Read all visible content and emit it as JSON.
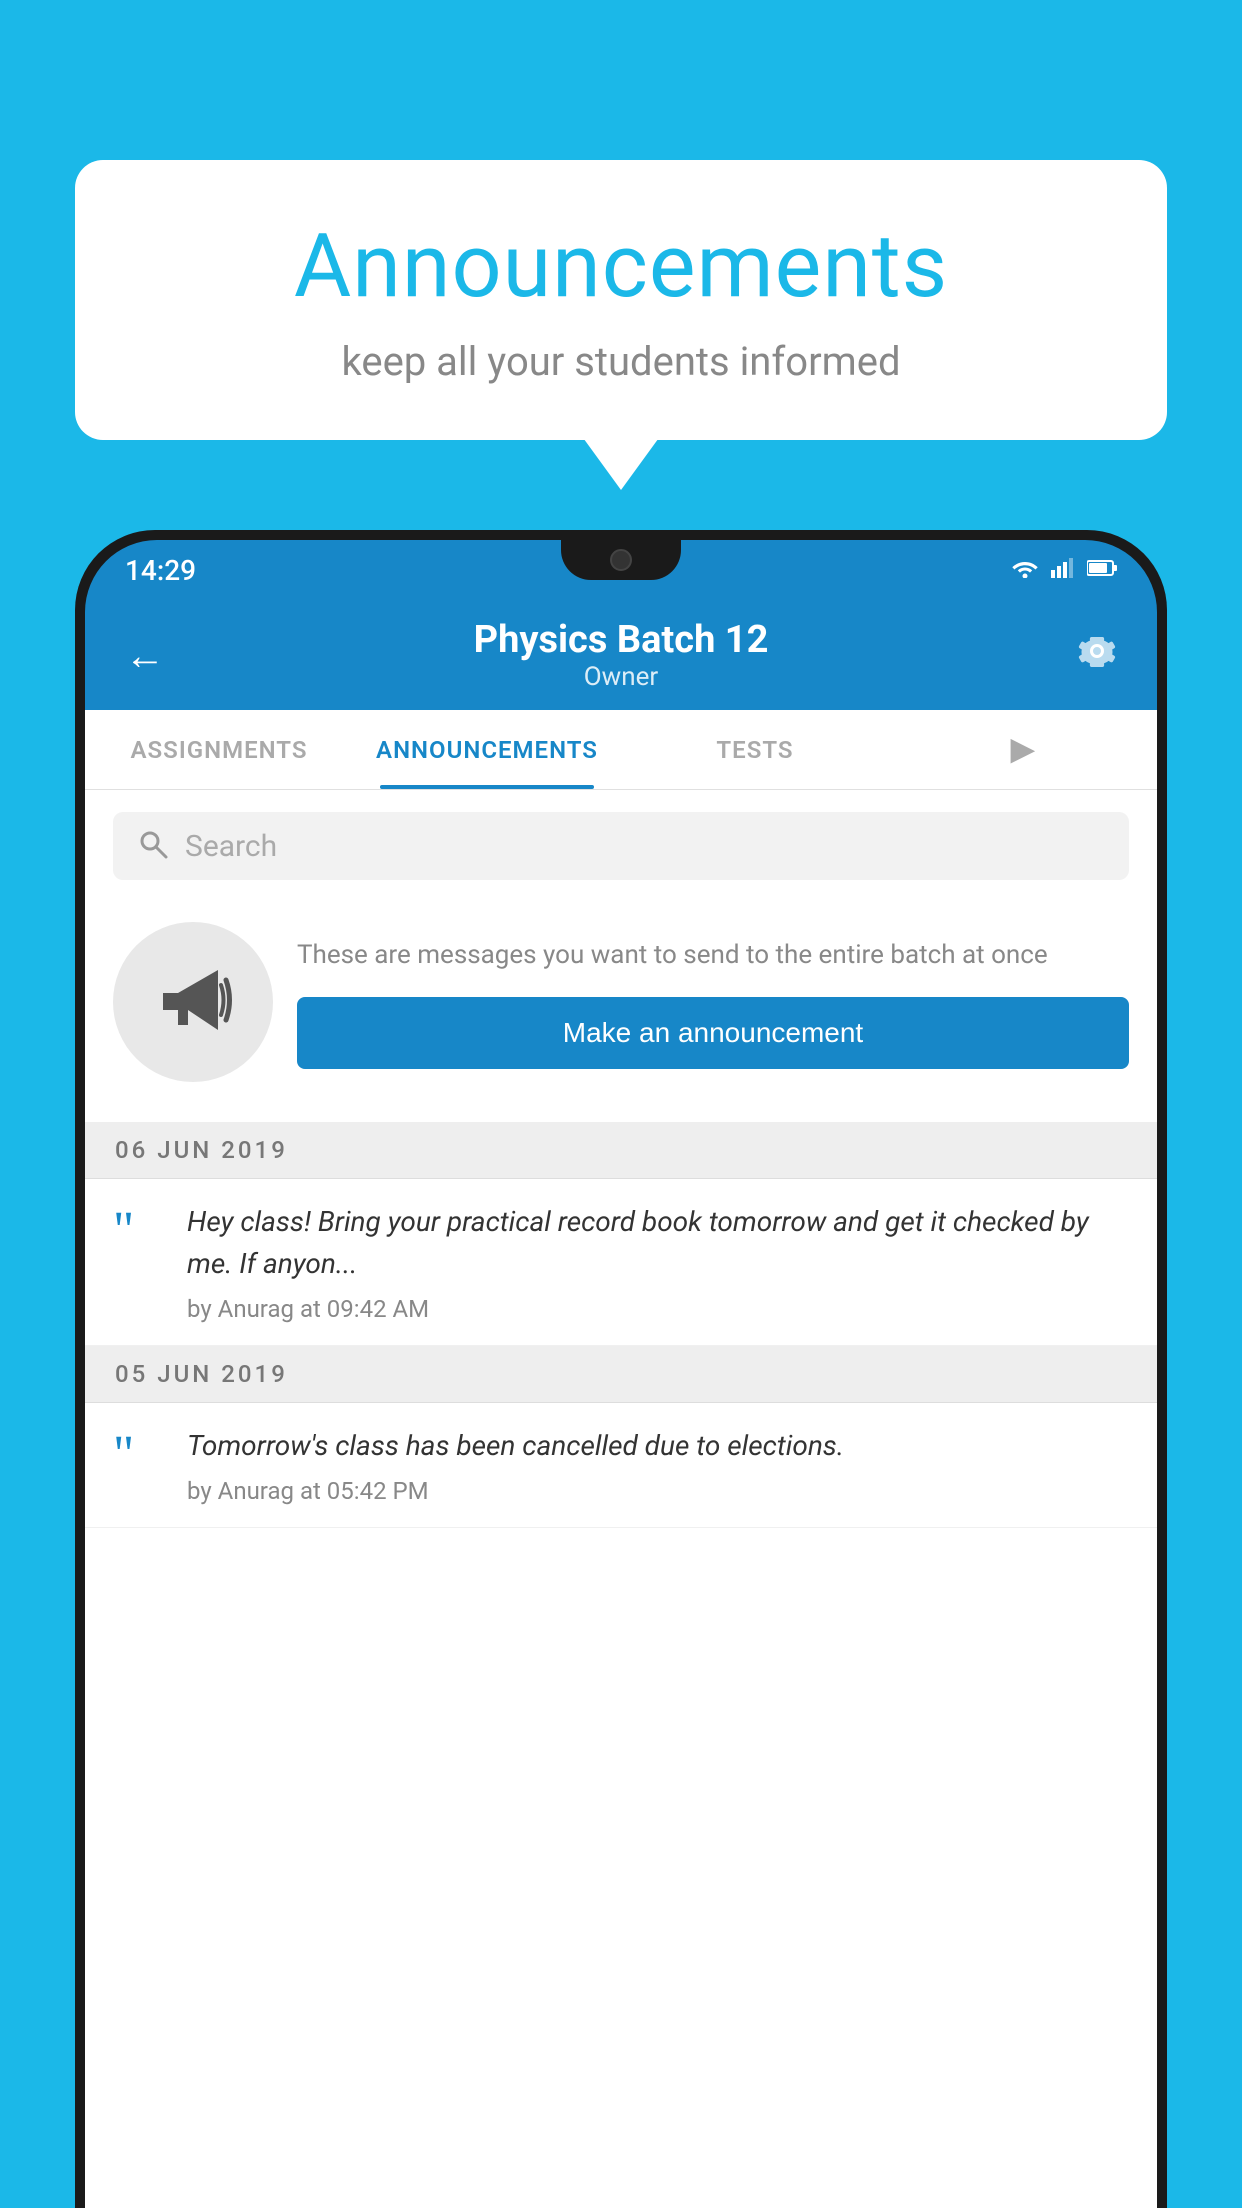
{
  "bubble": {
    "title": "Announcements",
    "subtitle": "keep all your students informed"
  },
  "status_bar": {
    "time": "14:29",
    "wifi": "▼",
    "signal": "◀",
    "battery": "▮"
  },
  "app_bar": {
    "title": "Physics Batch 12",
    "subtitle": "Owner",
    "back_label": "←",
    "settings_label": "⚙"
  },
  "tabs": [
    {
      "label": "ASSIGNMENTS",
      "active": false
    },
    {
      "label": "ANNOUNCEMENTS",
      "active": true
    },
    {
      "label": "TESTS",
      "active": false
    },
    {
      "label": "•••",
      "active": false
    }
  ],
  "search": {
    "placeholder": "Search"
  },
  "announcement_prompt": {
    "description": "These are messages you want to send to the entire batch at once",
    "button_label": "Make an announcement"
  },
  "announcements": [
    {
      "date": "06  JUN  2019",
      "text": "Hey class! Bring your practical record book tomorrow and get it checked by me. If anyon...",
      "meta": "by Anurag at 09:42 AM"
    },
    {
      "date": "05  JUN  2019",
      "text": "Tomorrow's class has been cancelled due to elections.",
      "meta": "by Anurag at 05:42 PM"
    }
  ]
}
